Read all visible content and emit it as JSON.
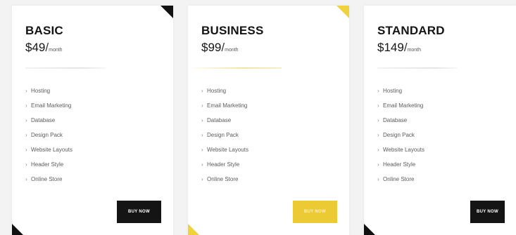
{
  "colors": {
    "page_background": "#f3f3f3",
    "card_background": "#ffffff",
    "dark_accent": "#141414",
    "yellow_accent": "#ecca34"
  },
  "plans": [
    {
      "name": "BASIC",
      "price": "$49",
      "separator": "/",
      "period": "month",
      "features": [
        "Hosting",
        "Email Marketing",
        "Database",
        "Design Pack",
        "Website Layouts",
        "Header Style",
        "Online Store"
      ],
      "button_label": "BUY NOW"
    },
    {
      "name": "BUSINESS",
      "price": "$99",
      "separator": "/",
      "period": "month",
      "features": [
        "Hosting",
        "Email Marketing",
        "Database",
        "Design Pack",
        "Website Layouts",
        "Header Style",
        "Online Store"
      ],
      "button_label": "BUY NOW"
    },
    {
      "name": "STANDARD",
      "price": "$149",
      "separator": "/",
      "period": "month",
      "features": [
        "Hosting",
        "Email Marketing",
        "Database",
        "Design Pack",
        "Website Layouts",
        "Header Style",
        "Online Store"
      ],
      "button_label": "BUY NOW"
    }
  ],
  "icons": {
    "feature_bullet": "chevron-right-icon",
    "corner_top": "corner-triangle-icon",
    "corner_bottom": "corner-triangle-icon"
  }
}
